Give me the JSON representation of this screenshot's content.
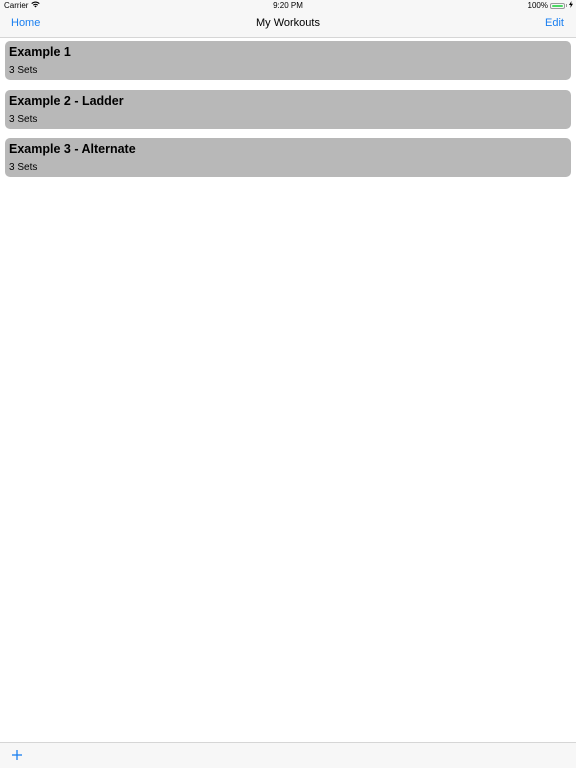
{
  "status_bar": {
    "carrier": "Carrier",
    "time": "9:20 PM",
    "battery": "100%",
    "battery_level": 1.0
  },
  "nav": {
    "left_label": "Home",
    "title": "My Workouts",
    "right_label": "Edit"
  },
  "workouts": [
    {
      "title": "Example 1",
      "subtitle": "3 Sets"
    },
    {
      "title": "Example 2 - Ladder",
      "subtitle": "3 Sets"
    },
    {
      "title": "Example 3 - Alternate",
      "subtitle": "3 Sets"
    }
  ],
  "toolbar": {
    "add_icon": "plus-icon"
  },
  "colors": {
    "accent": "#1a7ff0",
    "card_bg": "#b8b8b8",
    "bar_bg": "#f7f7f7",
    "battery_fill": "#4cd964"
  }
}
